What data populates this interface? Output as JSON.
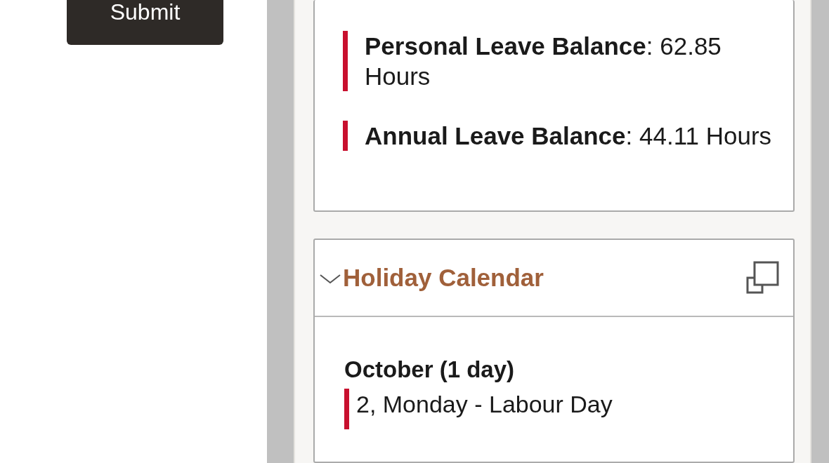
{
  "form": {
    "submit_button": "Submit"
  },
  "balances": [
    {
      "text": "**Personal Leave Balance**: 62.85 Hours"
    },
    {
      "text": "**Annual Leave Balance**: 44.11 Hours"
    }
  ],
  "holiday_calendar": {
    "title": "Holiday Calendar",
    "expanded": true,
    "months": [
      {
        "heading": "October (1 day)",
        "holidays": [
          "2, Monday - Labour Day"
        ]
      }
    ]
  }
}
